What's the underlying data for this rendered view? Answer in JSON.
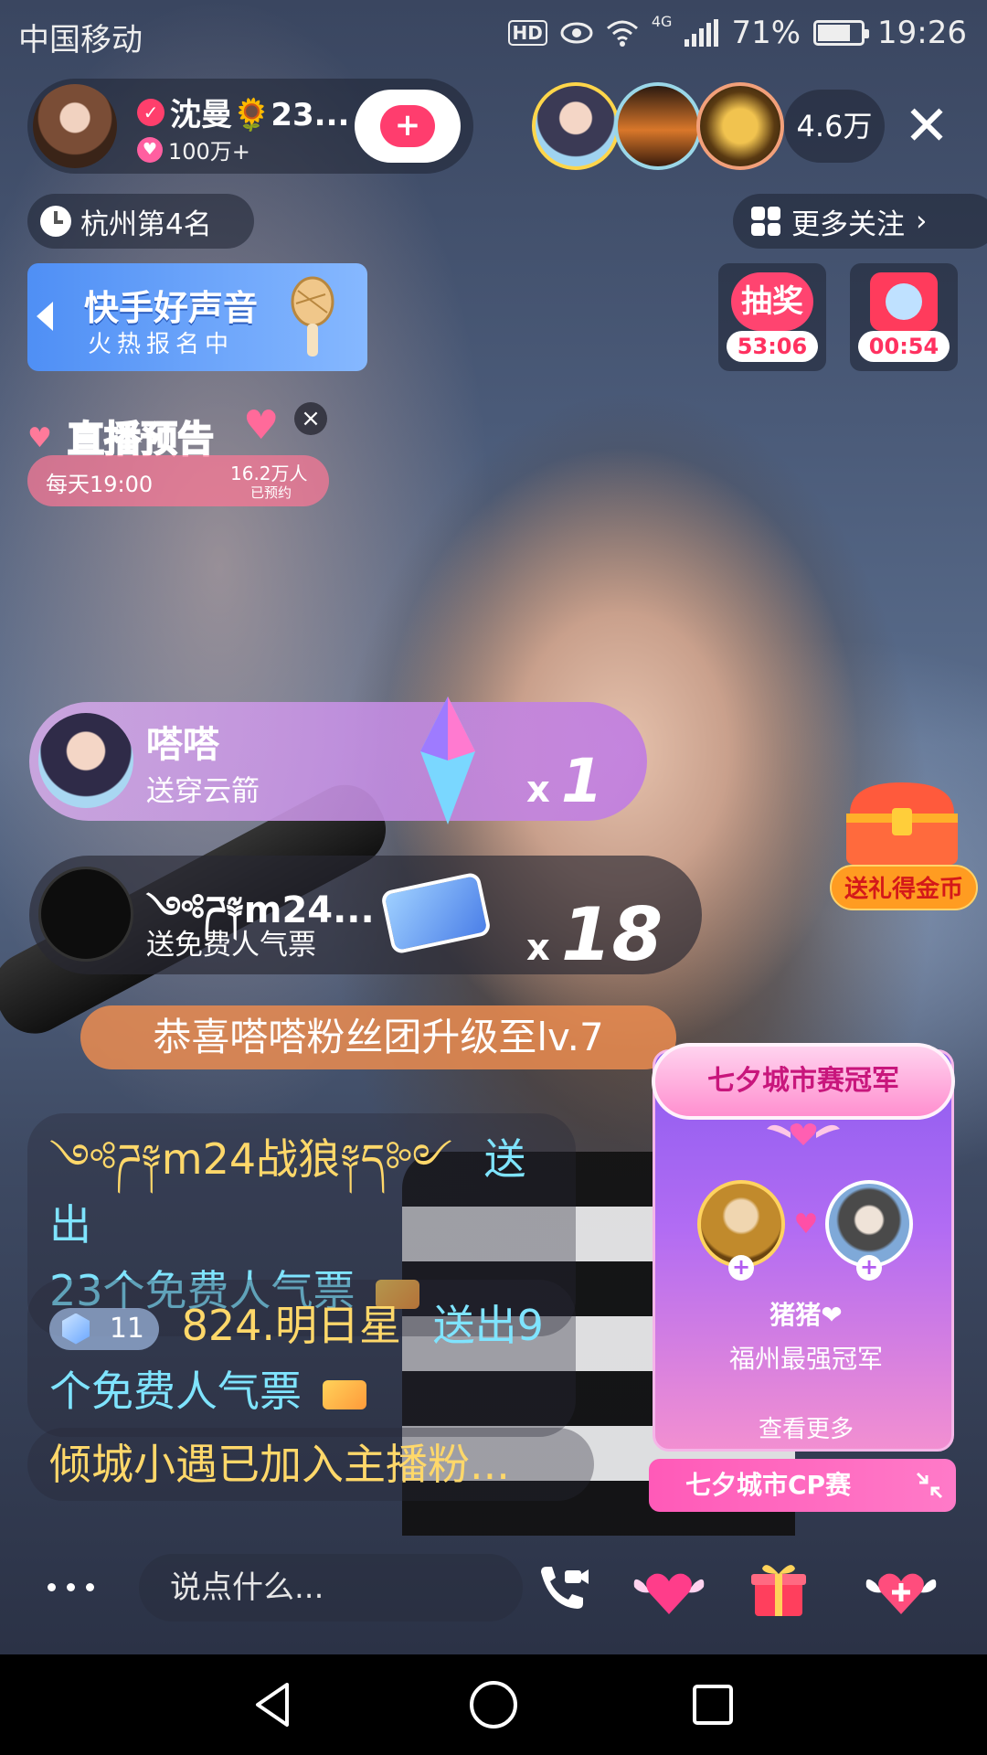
{
  "status_bar": {
    "carrier": "中国移动",
    "hd": "HD",
    "network": "4G",
    "battery": "71%",
    "time": "19:26"
  },
  "host": {
    "name": "沈曼🌻23...",
    "fans": "100万+"
  },
  "viewers": {
    "count": "4.6万"
  },
  "rank": {
    "label": "杭州第4名"
  },
  "more_follow": {
    "label": "更多关注"
  },
  "voice_banner": {
    "title": "快手好声音",
    "subtitle": "火热报名中"
  },
  "lotteries": [
    {
      "label": "抽奖",
      "time": "53:06"
    },
    {
      "time": "00:54"
    }
  ],
  "preview": {
    "title": "直播预告",
    "schedule": "每天19:00",
    "count": "16.2万人",
    "booked": "已预约"
  },
  "gifts": [
    {
      "user": "嗒嗒",
      "desc": "送穿云箭",
      "mult_x": "x",
      "mult_n": "1"
    },
    {
      "user": "༺ཌ༈m24...",
      "desc": "送免费人气票",
      "mult_x": "x",
      "mult_n": "18"
    }
  ],
  "treasure": {
    "label": "送礼得金币"
  },
  "chat": {
    "congrats": "恭喜嗒嗒粉丝团升级至lv.7",
    "m1_user": "༺ཌ༈m24战狼༈ད༻",
    "m1_action": "送出",
    "m1_text": "23个免费人气票",
    "m2_level": "11",
    "m2_user": "824.明日星",
    "m2_action": "送出9",
    "m2_text": "个免费人气票",
    "m3": "倾城小遇已加入主播粉..."
  },
  "cp_card": {
    "title": "七夕城市赛冠军",
    "name": "猪猪❤",
    "subtitle": "福州最强冠军",
    "more": "查看更多",
    "footer": "七夕城市CP赛"
  },
  "bottom": {
    "input_placeholder": "说点什么..."
  },
  "colors": {
    "accent_pink": "#ff3d6e",
    "chat_gold": "#ffd86a",
    "chat_cyan": "#7fe4ff",
    "cp_purple": "#8d5cf0"
  }
}
